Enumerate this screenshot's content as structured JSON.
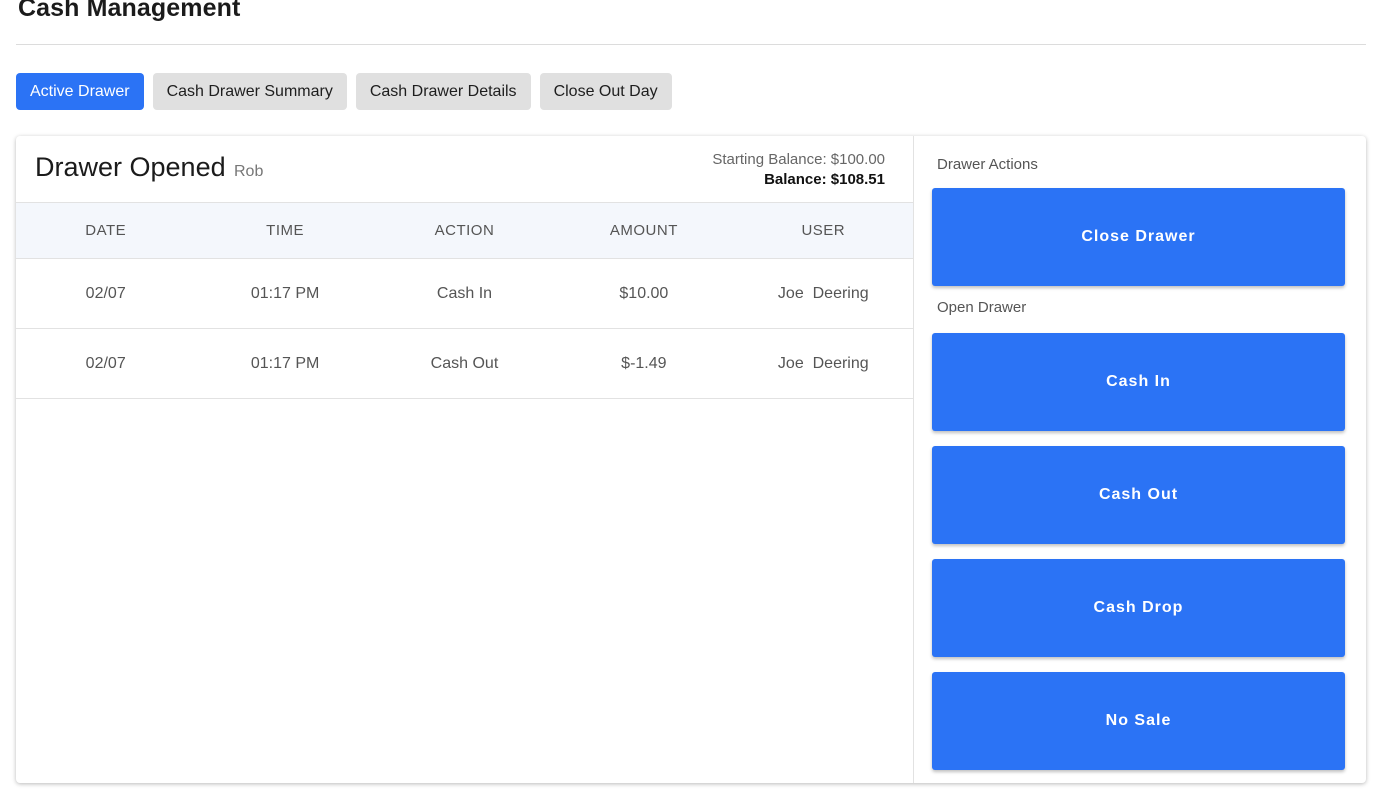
{
  "page": {
    "title": "Cash Management"
  },
  "tabs": [
    {
      "label": "Active Drawer",
      "active": true
    },
    {
      "label": "Cash Drawer Summary",
      "active": false
    },
    {
      "label": "Cash Drawer Details",
      "active": false
    },
    {
      "label": "Close Out Day",
      "active": false
    }
  ],
  "drawer": {
    "title": "Drawer Opened",
    "user": "Rob",
    "starting_balance": "Starting Balance: $100.00",
    "balance": "Balance: $108.51"
  },
  "table": {
    "headers": [
      "DATE",
      "TIME",
      "ACTION",
      "AMOUNT",
      "USER"
    ],
    "rows": [
      [
        "02/07",
        "01:17 PM",
        "Cash In",
        "$10.00",
        "Joe  Deering"
      ],
      [
        "02/07",
        "01:17 PM",
        "Cash Out",
        "$-1.49",
        "Joe  Deering"
      ]
    ]
  },
  "actions": {
    "drawer_actions_label": "Drawer Actions",
    "close_drawer": "Close Drawer",
    "open_drawer_label": "Open Drawer",
    "cash_in": "Cash In",
    "cash_out": "Cash Out",
    "cash_drop": "Cash Drop",
    "no_sale": "No Sale"
  },
  "colors": {
    "accent": "#2b73f5",
    "tab_inactive": "#e0e0e0",
    "header_bg": "#f4f7fc"
  }
}
